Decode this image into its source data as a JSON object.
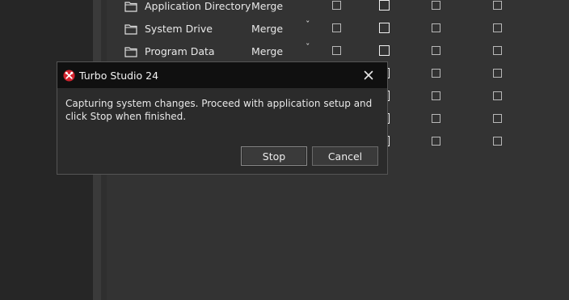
{
  "rows": [
    {
      "name": "Application Directory",
      "mode": "Merge"
    },
    {
      "name": "System Drive",
      "mode": "Merge"
    },
    {
      "name": "Program Data",
      "mode": "Merge"
    }
  ],
  "chevron": "ˇ",
  "dialog": {
    "title": "Turbo Studio 24",
    "message": "Capturing system changes. Proceed with application setup and click Stop when finished.",
    "stop_label": "Stop",
    "cancel_label": "Cancel",
    "close_glyph": "✕"
  },
  "colors": {
    "background": "#333333",
    "dialog_title_bar": "#101010",
    "app_icon": "#d4232e"
  }
}
